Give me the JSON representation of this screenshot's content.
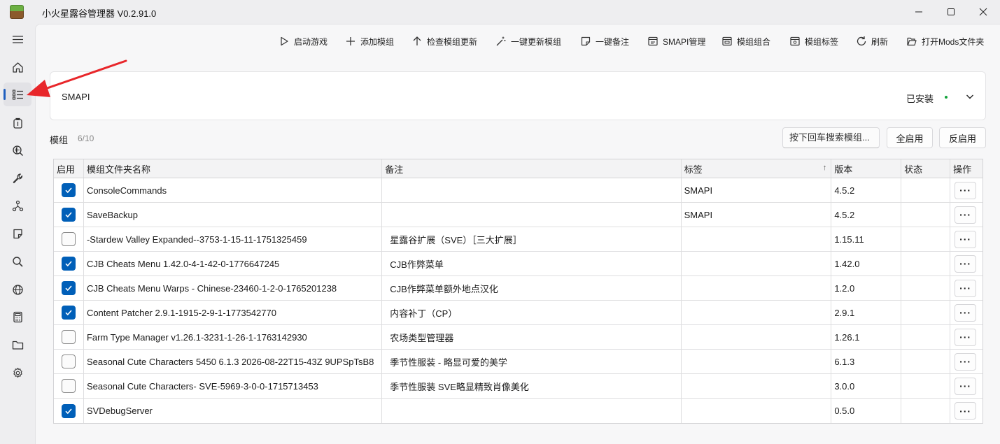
{
  "app": {
    "title": "小火星露谷管理器 V0.2.91.0"
  },
  "nav": [
    {
      "icon": "menu-icon"
    },
    {
      "icon": "home-icon"
    },
    {
      "icon": "list-icon",
      "active": true
    },
    {
      "icon": "backpack-icon"
    },
    {
      "icon": "search-globe-icon"
    },
    {
      "icon": "wrench-icon"
    },
    {
      "icon": "network-icon"
    },
    {
      "icon": "note-icon"
    },
    {
      "icon": "search-icon"
    },
    {
      "icon": "globe-icon"
    },
    {
      "icon": "calculator-icon"
    },
    {
      "icon": "folder-icon"
    },
    {
      "icon": "settings-icon"
    }
  ],
  "toolbar": [
    {
      "label": "启动游戏",
      "icon": "play-icon"
    },
    {
      "label": "添加模组",
      "icon": "plus-icon"
    },
    {
      "label": "检查模组更新",
      "icon": "arrow-up-icon"
    },
    {
      "label": "一键更新模组",
      "icon": "wand-icon"
    },
    {
      "label": "一键备注",
      "icon": "note-icon"
    },
    {
      "label": "SMAPI管理",
      "icon": "smapi-icon"
    },
    {
      "label": "模组组合",
      "icon": "combo-icon"
    },
    {
      "label": "模组标签",
      "icon": "tag-icon"
    },
    {
      "label": "刷新",
      "icon": "refresh-icon"
    },
    {
      "label": "打开Mods文件夹",
      "icon": "open-folder-icon"
    }
  ],
  "smapi": {
    "name": "SMAPI",
    "status": "已安装"
  },
  "mods_header": {
    "label": "模组",
    "count": "6/10"
  },
  "search": {
    "placeholder": "按下回车搜索模组..."
  },
  "buttons": {
    "enable_all": "全启用",
    "invert": "反启用"
  },
  "table": {
    "columns": [
      "启用",
      "模组文件夹名称",
      "备注",
      "标签",
      "版本",
      "状态",
      "操作"
    ],
    "sort_indicator": "↑",
    "rows": [
      {
        "enabled": true,
        "name": "ConsoleCommands",
        "note": "",
        "tag": "SMAPI",
        "version": "4.5.2",
        "status": ""
      },
      {
        "enabled": true,
        "name": "SaveBackup",
        "note": "",
        "tag": "SMAPI",
        "version": "4.5.2",
        "status": ""
      },
      {
        "enabled": false,
        "name": "-Stardew Valley Expanded--3753-1-15-11-1751325459",
        "note": "星露谷扩展（SVE）［三大扩展］",
        "tag": "",
        "version": "1.15.11",
        "status": ""
      },
      {
        "enabled": true,
        "name": "CJB Cheats Menu 1.42.0-4-1-42-0-1776647245",
        "note": "CJB作弊菜单",
        "tag": "",
        "version": "1.42.0",
        "status": ""
      },
      {
        "enabled": true,
        "name": "CJB Cheats Menu Warps - Chinese-23460-1-2-0-1765201238",
        "note": "CJB作弊菜单额外地点汉化",
        "tag": "",
        "version": "1.2.0",
        "status": ""
      },
      {
        "enabled": true,
        "name": "Content Patcher 2.9.1-1915-2-9-1-1773542770",
        "note": "内容补丁（CP）",
        "tag": "",
        "version": "2.9.1",
        "status": ""
      },
      {
        "enabled": false,
        "name": "Farm Type Manager v1.26.1-3231-1-26-1-1763142930",
        "note": "农场类型管理器",
        "tag": "",
        "version": "1.26.1",
        "status": ""
      },
      {
        "enabled": false,
        "name": "Seasonal Cute Characters 5450 6.1.3 2026-08-22T15-43Z 9UPSpTsB8",
        "note": "季节性服装 - 略显可爱的美学",
        "tag": "",
        "version": "6.1.3",
        "status": ""
      },
      {
        "enabled": false,
        "name": "Seasonal Cute Characters- SVE-5969-3-0-0-1715713453",
        "note": "季节性服装 SVE略显精致肖像美化",
        "tag": "",
        "version": "3.0.0",
        "status": ""
      },
      {
        "enabled": true,
        "name": "SVDebugServer",
        "note": "",
        "tag": "",
        "version": "0.5.0",
        "status": ""
      }
    ],
    "action_label": "···"
  },
  "colors": {
    "accent": "#005fb8",
    "annotation_arrow": "#e8262a",
    "installed_dot": "#12a33a"
  }
}
